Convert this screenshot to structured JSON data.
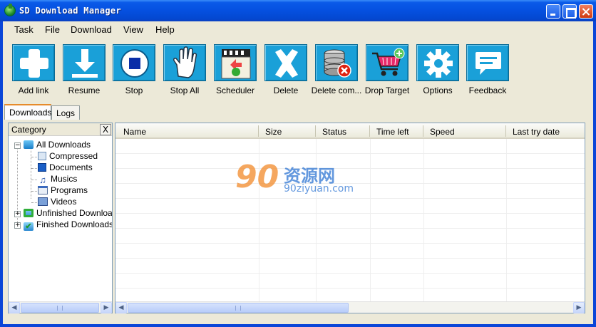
{
  "window": {
    "title": "SD Download Manager"
  },
  "colors": {
    "titlebar": "#0550e0",
    "toolbar_icon_bg": "#1aa0d8",
    "client_bg": "#ece9d8"
  },
  "menu": [
    "Task",
    "File",
    "Download",
    "View",
    "Help"
  ],
  "toolbar": [
    {
      "label": "Add link",
      "icon": "plus-icon"
    },
    {
      "label": "Resume",
      "icon": "download-arrow-icon"
    },
    {
      "label": "Stop",
      "icon": "stop-icon"
    },
    {
      "label": "Stop All",
      "icon": "hand-icon"
    },
    {
      "label": "Scheduler",
      "icon": "calendar-icon"
    },
    {
      "label": "Delete",
      "icon": "delete-x-icon"
    },
    {
      "label": "Delete com...",
      "icon": "database-delete-icon"
    },
    {
      "label": "Drop Target",
      "icon": "shopping-cart-icon"
    },
    {
      "label": "Options",
      "icon": "gear-icon"
    },
    {
      "label": "Feedback",
      "icon": "speech-bubble-icon"
    }
  ],
  "tabs": [
    "Downloads",
    "Logs"
  ],
  "sidebar": {
    "title": "Category",
    "close_label": "X",
    "tree": {
      "root": "All Downloads",
      "children": [
        "Compressed",
        "Documents",
        "Musics",
        "Programs",
        "Videos"
      ],
      "unfinished": "Unfinished Downloads",
      "finished": "Finished Downloads"
    }
  },
  "grid": {
    "columns": [
      "Name",
      "Size",
      "Status",
      "Time left",
      "Speed",
      "Last try date"
    ]
  },
  "watermark": {
    "number": "90",
    "chinese": "资源网",
    "url": "90ziyuan.com"
  }
}
